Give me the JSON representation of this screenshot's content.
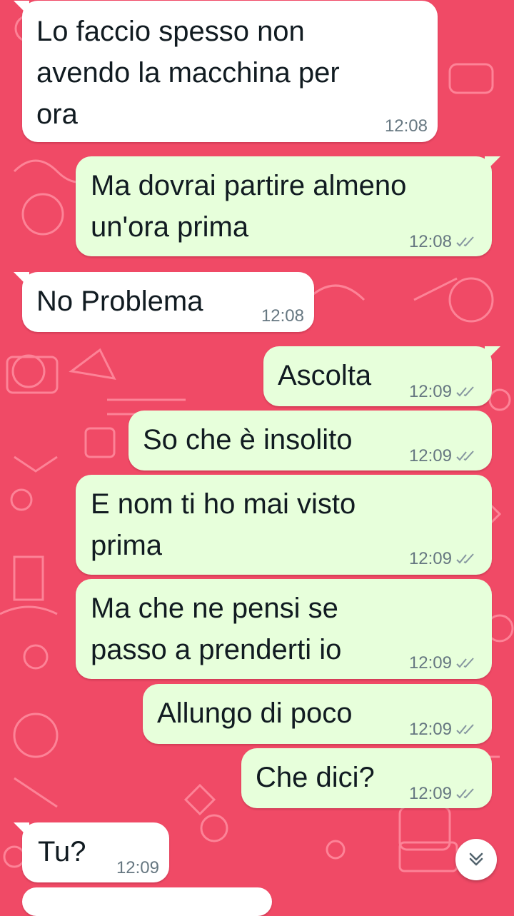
{
  "chat": {
    "messages": [
      {
        "direction": "in",
        "text": "Lo faccio spesso non\navendo la macchina per\nora",
        "time": "12:08"
      },
      {
        "direction": "out",
        "text": "Ma dovrai partire almeno\nun'ora prima",
        "time": "12:08",
        "status": "read-double-check"
      },
      {
        "direction": "in",
        "text": "No Problema",
        "time": "12:08"
      },
      {
        "direction": "out",
        "text": "Ascolta",
        "time": "12:09",
        "status": "read-double-check"
      },
      {
        "direction": "out",
        "text": "So che è insolito",
        "time": "12:09",
        "status": "read-double-check"
      },
      {
        "direction": "out",
        "text": "E nom ti ho mai visto\nprima",
        "time": "12:09",
        "status": "read-double-check"
      },
      {
        "direction": "out",
        "text": "Ma che ne pensi se\npasso a prenderti io",
        "time": "12:09",
        "status": "read-double-check"
      },
      {
        "direction": "out",
        "text": "Allungo di poco",
        "time": "12:09",
        "status": "read-double-check"
      },
      {
        "direction": "out",
        "text": "Che dici?",
        "time": "12:09",
        "status": "read-double-check"
      },
      {
        "direction": "in",
        "text": "Tu?",
        "time": "12:09"
      }
    ]
  },
  "scroll_button": {
    "icon": "double-chevron-down-icon"
  },
  "colors": {
    "wallpaper": "#f04a66",
    "incoming_bubble": "#ffffff",
    "outgoing_bubble": "#e7ffdb",
    "timestamp": "#667781",
    "text": "#111b21"
  }
}
